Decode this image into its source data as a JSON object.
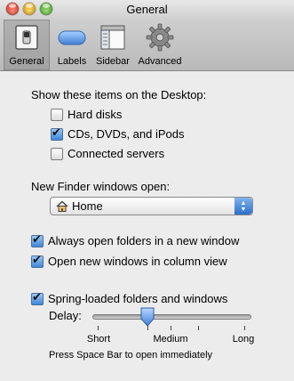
{
  "window": {
    "title": "General"
  },
  "toolbar": {
    "items": [
      {
        "label": "General",
        "icon": "finder-switch-icon",
        "selected": true
      },
      {
        "label": "Labels",
        "icon": "label-pill-icon",
        "selected": false
      },
      {
        "label": "Sidebar",
        "icon": "sidebar-icon",
        "selected": false
      },
      {
        "label": "Advanced",
        "icon": "gear-icon",
        "selected": false
      }
    ]
  },
  "desktop": {
    "heading": "Show these items on the Desktop:",
    "options": [
      {
        "label": "Hard disks",
        "checked": false
      },
      {
        "label": "CDs, DVDs, and iPods",
        "checked": true
      },
      {
        "label": "Connected servers",
        "checked": false
      }
    ]
  },
  "new_window": {
    "heading": "New Finder windows open:",
    "selected": "Home",
    "icon": "home-icon"
  },
  "window_options": [
    {
      "label": "Always open folders in a new window",
      "checked": true
    },
    {
      "label": "Open new windows in column view",
      "checked": true
    }
  ],
  "spring": {
    "label": "Spring-loaded folders and windows",
    "checked": true,
    "delay_label": "Delay:",
    "ticks": [
      "Short",
      "Medium",
      "Long"
    ],
    "value": 0.35,
    "hint": "Press Space Bar to open immediately"
  },
  "colors": {
    "accent": "#3d86d8",
    "background": "#ececec"
  }
}
